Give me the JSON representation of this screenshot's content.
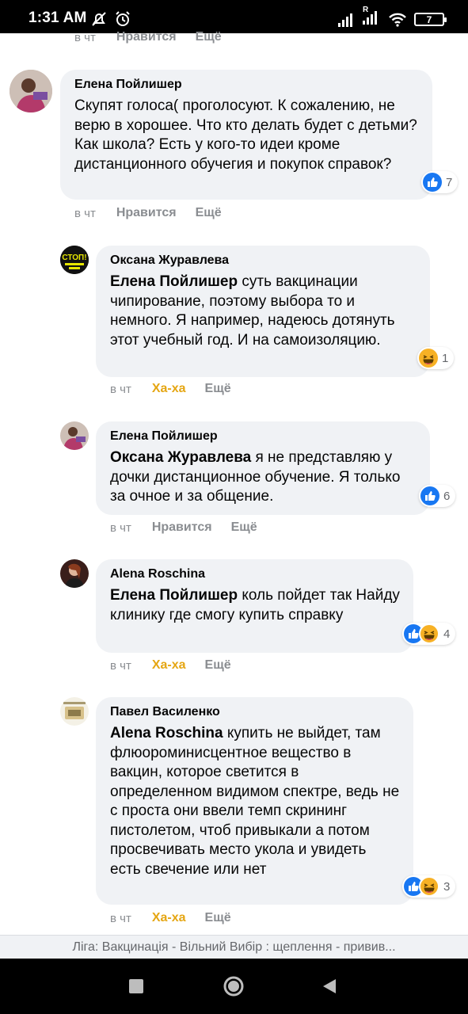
{
  "status": {
    "time": "1:31 AM",
    "battery": "7",
    "network_label": "R"
  },
  "top_actions": {
    "time": "в чт",
    "like": "Нравится",
    "more": "Ещё"
  },
  "comments": [
    {
      "author": "Елена Пойлишер",
      "mention": "",
      "text": "Скупят голоса( проголосуют. К сожалению, не верю в хорошее. Что кто делать будет с детьми? Как школа? Есть у кого-то идеи кроме дистанционного обучегия и покупок справок?",
      "reaction_count": "7",
      "time": "в чт",
      "reaction_action": "Нравится",
      "more": "Ещё"
    },
    {
      "author": "Оксана Журавлева",
      "avatar_text": "СТОП!",
      "mention": "Елена Пойлишер",
      "text": " суть вакцинации чипирование, поэтому выбора то и немного. Я например, надеюсь дотянуть этот учебный год. И на самоизоляцию.",
      "reaction_count": "1",
      "time": "в чт",
      "reaction_action": "Ха-ха",
      "more": "Ещё"
    },
    {
      "author": "Елена Пойлишер",
      "mention": "Оксана Журавлева",
      "text": " я не представляю у дочки дистанционное обучение. Я только за очное и за общение.",
      "reaction_count": "6",
      "time": "в чт",
      "reaction_action": "Нравится",
      "more": "Ещё"
    },
    {
      "author": "Alena Roschina",
      "mention": "Елена Пойлишер",
      "text": " коль пойдет так Найду клинику где смогу купить справку",
      "reaction_count": "4",
      "time": "в чт",
      "reaction_action": "Ха-ха",
      "more": "Ещё"
    },
    {
      "author": "Павел Василенко",
      "mention": "Alena Roschina",
      "text": " купить не выйдет, там флюороминисцентное вещество в вакцин, которое светится в определенном видимом спектре, ведь не с проста они ввели темп скрининг пистолетом, чтоб привыкали а потом просвечивать место укола и увидеть есть свечение или нет",
      "reaction_count": "3",
      "time": "в чт",
      "reaction_action": "Ха-ха",
      "more": "Ещё"
    }
  ],
  "banner": {
    "text": "Ліга: Вакцинація - Вільний Вибір : щеплення - привив..."
  },
  "colors": {
    "like_blue": "#1877f2",
    "haha_yellow": "#f7b125",
    "bubble": "#f0f2f5",
    "haha_text": "#e5a613"
  },
  "icons": [
    "like-icon",
    "haha-icon",
    "square-nav-icon",
    "home-circle-icon",
    "back-triangle-icon"
  ]
}
